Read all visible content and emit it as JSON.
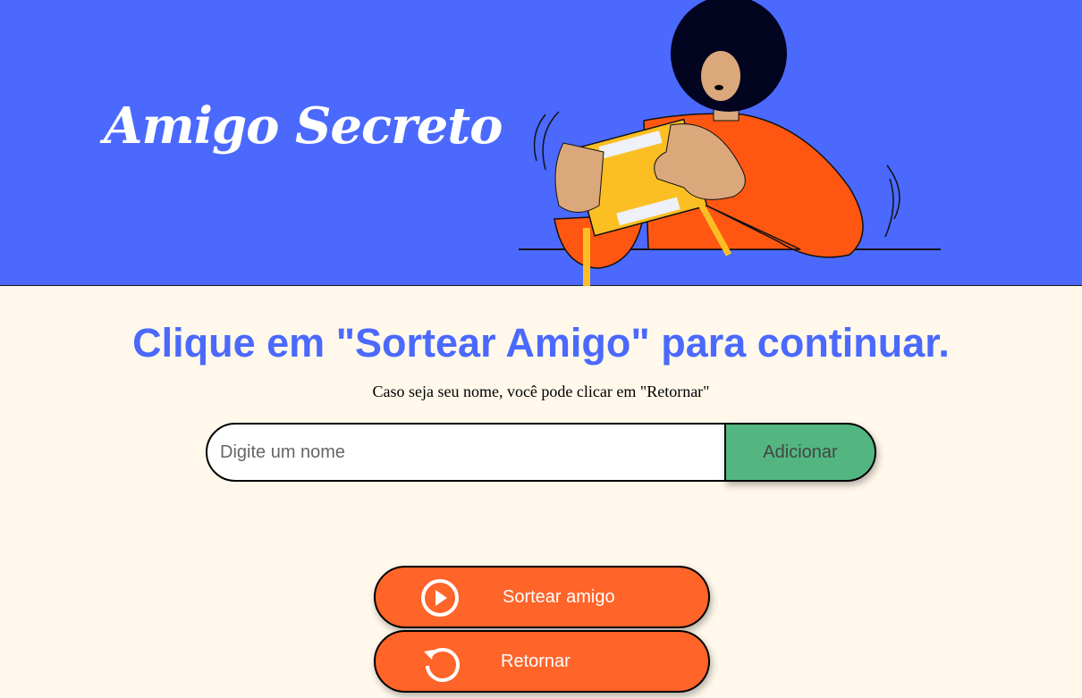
{
  "header": {
    "title": "Amigo Secreto"
  },
  "main": {
    "heading": "Clique em \"Sortear Amigo\" para continuar.",
    "subtitle": "Caso seja seu nome, você pode clicar em \"Retornar\"",
    "name_input": {
      "placeholder": "Digite um nome",
      "value": ""
    },
    "add_label": "Adicionar",
    "draw_label": "Sortear amigo",
    "return_label": "Retornar"
  },
  "colors": {
    "primary": "#4b69fd",
    "accent": "#ff6429",
    "add": "#53b680",
    "background": "#fff8eb"
  },
  "icons": {
    "draw": "play-circle-icon",
    "return": "refresh-icon"
  }
}
